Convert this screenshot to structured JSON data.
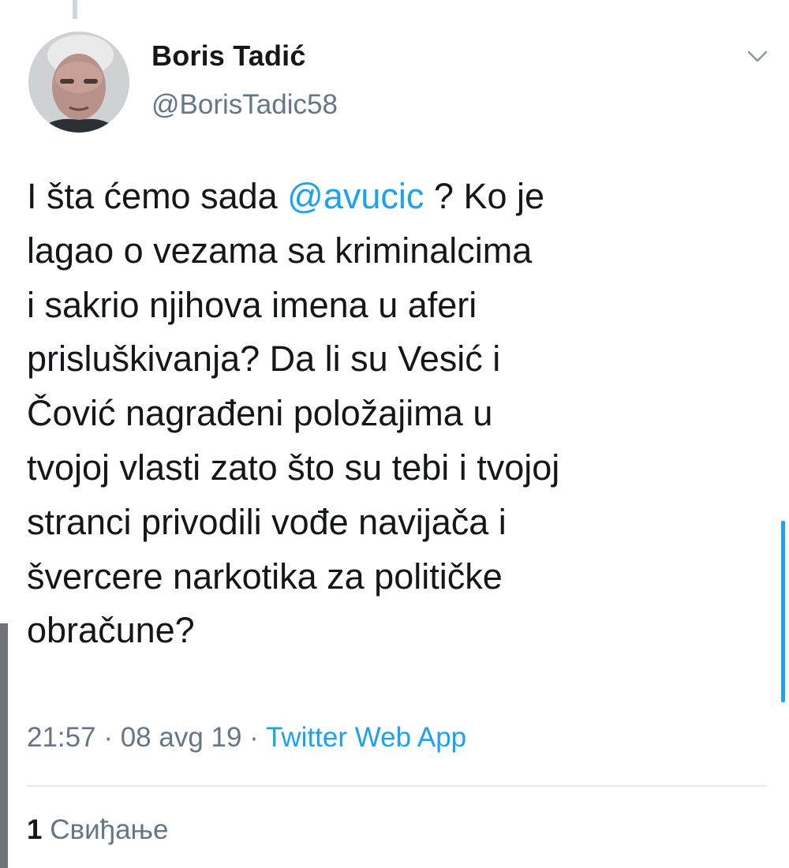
{
  "tweet": {
    "author": {
      "display_name": "Boris Tadić",
      "handle": "@BorisTadic58",
      "avatar_icon": "user-avatar-photo"
    },
    "menu_icon": "chevron-down-icon",
    "text_lines": {
      "l1_before": "I šta ćemo sada ",
      "l1_mention": "@avucic",
      "l1_after": " ? Ko je",
      "l2": "lagao o vezama sa kriminalcima",
      "l3": "i sakrio njihova imena u aferi",
      "l4": "prisluškivanja? Da li su Vesić i",
      "l5": "Čović nagrađeni položajima u",
      "l6": "tvojoj vlasti zato što su tebi i tvojoj",
      "l7": "stranci privodili vođe navijača i",
      "l8": "švercere narkotika za političke",
      "l9": "obračune?"
    },
    "time": "21:57",
    "date": "08 avg 19",
    "separator": " · ",
    "source": "Twitter Web App",
    "likes_count": "1",
    "likes_label": " Свиђање"
  },
  "colors": {
    "link": "#1da1f2",
    "secondary_text": "#657786",
    "primary_text": "#14171a"
  }
}
